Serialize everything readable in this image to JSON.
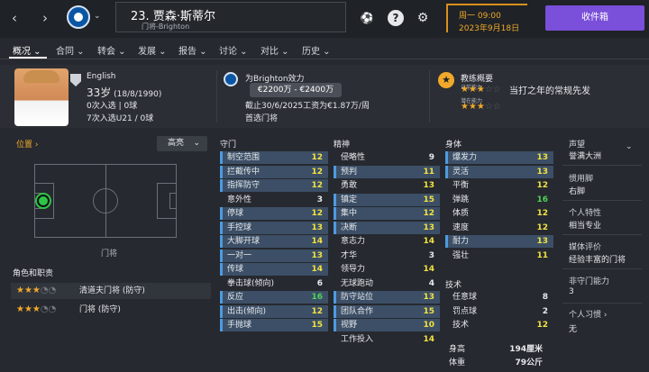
{
  "topbar": {
    "back_icon": "chevron-left-icon",
    "forward_icon": "chevron-right-icon",
    "player_number": "23.",
    "player_name": "贾森·斯蒂尔",
    "player_subtitle": "门将-Brighton",
    "date_day": "周一 09:00",
    "date_date": "2023年9月18日",
    "inbox_label": "收件箱"
  },
  "tabs": [
    {
      "label": "概况",
      "active": true
    },
    {
      "label": "合同"
    },
    {
      "label": "转会"
    },
    {
      "label": "发展"
    },
    {
      "label": "报告"
    },
    {
      "label": "讨论"
    },
    {
      "label": "对比"
    },
    {
      "label": "历史"
    }
  ],
  "profile": {
    "nationality": "English",
    "age": "33岁",
    "birth": "(18/8/1990)",
    "caps": "0次入选 | 0球",
    "u21_caps": "7次入选U21 / 0球",
    "club_line": "为Brighton效力",
    "wage_range": "€2200万 - €2400万",
    "contract": "截止30/6/2025工资为€1.87万/周",
    "squad_status": "首选门将",
    "coach_title": "教练概要",
    "current_ability_label": "当前能力",
    "potential_label": "潜在能力",
    "ability_stars": 3,
    "ability_total": 5,
    "potential_stars": 3,
    "potential_total": 5,
    "ability_text": "当打之年的常规先发"
  },
  "position": {
    "title": "位置",
    "highlight_label": "高亮",
    "pitch_caption": "门将",
    "roles_title": "角色和职责",
    "roles": [
      {
        "name": "清道夫门将 (防守)",
        "stars": 3,
        "total": 5
      },
      {
        "name": "门将 (防守)",
        "stars": 3,
        "total": 5
      }
    ]
  },
  "goalkeeping": {
    "title": "守门",
    "items": [
      {
        "name": "制空范围",
        "value": "12"
      },
      {
        "name": "拦截传中",
        "value": "12"
      },
      {
        "name": "指挥防守",
        "value": "12"
      },
      {
        "name": "意外性",
        "value": "3"
      },
      {
        "name": "停球",
        "value": "12"
      },
      {
        "name": "手控球",
        "value": "13"
      },
      {
        "name": "大脚开球",
        "value": "14"
      },
      {
        "name": "一对一",
        "value": "13"
      },
      {
        "name": "传球",
        "value": "14"
      },
      {
        "name": "拳击球(倾向)",
        "value": "6"
      },
      {
        "name": "反应",
        "value": "16"
      },
      {
        "name": "出击(倾向)",
        "value": "12"
      },
      {
        "name": "手抛球",
        "value": "15"
      }
    ]
  },
  "mental": {
    "title": "精神",
    "items": [
      {
        "name": "侵略性",
        "value": "9"
      },
      {
        "name": "预判",
        "value": "11"
      },
      {
        "name": "勇敢",
        "value": "13"
      },
      {
        "name": "镇定",
        "value": "15"
      },
      {
        "name": "集中",
        "value": "12"
      },
      {
        "name": "决断",
        "value": "13"
      },
      {
        "name": "意志力",
        "value": "14"
      },
      {
        "name": "才华",
        "value": "3"
      },
      {
        "name": "领导力",
        "value": "14"
      },
      {
        "name": "无球跑动",
        "value": "4"
      },
      {
        "name": "防守站位",
        "value": "13"
      },
      {
        "name": "团队合作",
        "value": "15"
      },
      {
        "name": "视野",
        "value": "10"
      },
      {
        "name": "工作投入",
        "value": "14"
      }
    ]
  },
  "physical": {
    "title": "身体",
    "items": [
      {
        "name": "爆发力",
        "value": "13"
      },
      {
        "name": "灵活",
        "value": "13"
      },
      {
        "name": "平衡",
        "value": "12"
      },
      {
        "name": "弹跳",
        "value": "16"
      },
      {
        "name": "体质",
        "value": "12"
      },
      {
        "name": "速度",
        "value": "12"
      },
      {
        "name": "耐力",
        "value": "13"
      },
      {
        "name": "强壮",
        "value": "11"
      }
    ]
  },
  "technical": {
    "title": "技术",
    "items": [
      {
        "name": "任意球",
        "value": "8"
      },
      {
        "name": "罚点球",
        "value": "2"
      },
      {
        "name": "技术",
        "value": "12"
      }
    ]
  },
  "body": {
    "height_label": "身高",
    "height_value": "194厘米",
    "weight_label": "体重",
    "weight_value": "79公斤"
  },
  "sidebar": {
    "reputation_label": "声望",
    "reputation_value": "誉满大洲",
    "foot_label": "惯用脚",
    "foot_value": "右脚",
    "personality_label": "个人特性",
    "personality_value": "相当专业",
    "media_label": "媒体评价",
    "media_value": "经验丰富的门将",
    "nonfoot_label": "非守门能力",
    "nonfoot_value": "3",
    "habits_label": "个人习惯",
    "habits_value": "无"
  },
  "colors": {
    "accent": "#7a4fd9",
    "date": "#f0a92b",
    "highlight_row": "#3c4f66",
    "green_value": "#4fd358",
    "yellow_value": "#f2e240"
  }
}
